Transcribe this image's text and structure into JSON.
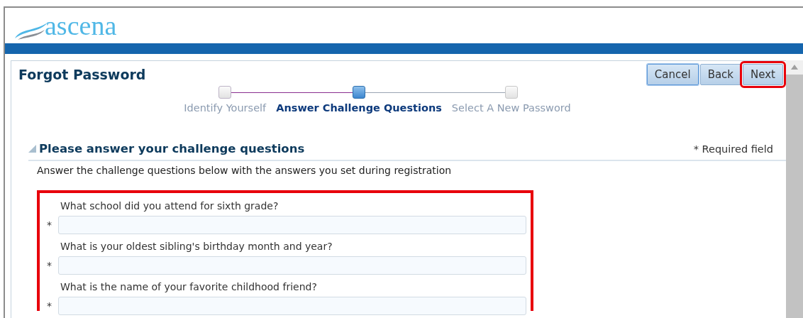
{
  "logo": {
    "text": "ascena"
  },
  "page": {
    "title": "Forgot Password"
  },
  "buttons": [
    {
      "label": "Cancel",
      "selected": true,
      "highlighted": false
    },
    {
      "label": "Back",
      "selected": false,
      "highlighted": false
    },
    {
      "label": "Next",
      "selected": false,
      "highlighted": true
    }
  ],
  "steps": [
    {
      "label": "Identify Yourself",
      "completed": true,
      "selected": false
    },
    {
      "label": "Answer Challenge Questions",
      "completed": false,
      "selected": true
    },
    {
      "label": "Select A New Password",
      "completed": false,
      "selected": false
    }
  ],
  "section": {
    "title": "Please answer your challenge questions",
    "expanded": true,
    "required_note": "* Required field",
    "instructions": "Answer the challenge questions below with the answers you set during registration",
    "highlighted": true,
    "questions": [
      {
        "label": "What school did you attend for sixth grade?",
        "required_mark": "*"
      },
      {
        "label": "What is your oldest sibling's birthday month and year?",
        "required_mark": "*"
      },
      {
        "label": "What is the name of your favorite childhood friend?",
        "required_mark": "*"
      }
    ]
  }
}
